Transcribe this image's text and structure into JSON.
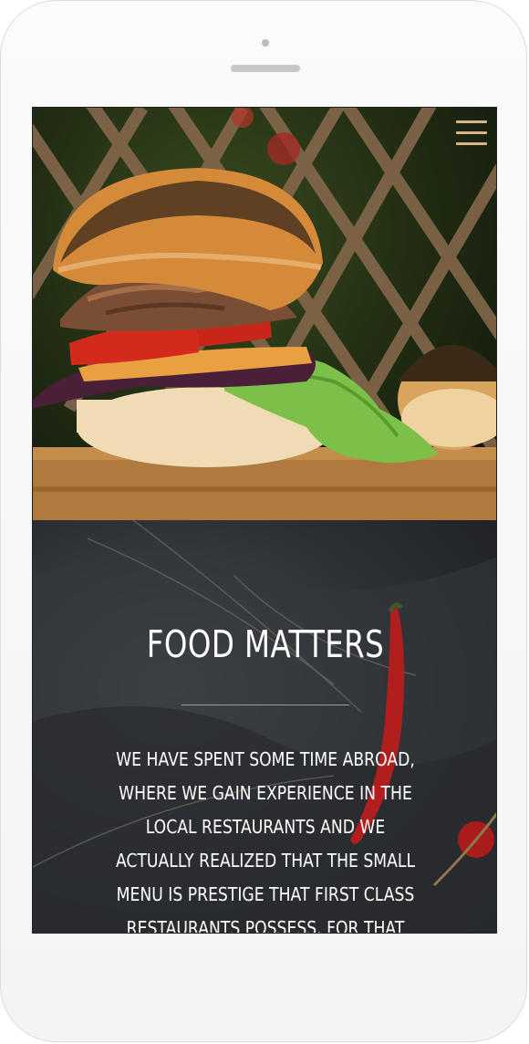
{
  "nav": {
    "menu_icon": "hamburger-icon"
  },
  "hero": {
    "image": "burger-photo"
  },
  "about": {
    "title": "FOOD MATTERS",
    "text": "WE HAVE SPENT SOME TIME ABROAD, WHERE WE GAIN EXPERIENCE IN THE LOCAL RESTAURANTS AND WE ACTUALLY REALIZED THAT THE SMALL MENU IS PRESTIGE THAT FIRST CLASS RESTAURANTS POSSESS. FOR THAT"
  },
  "colors": {
    "accent": "#d8b48a",
    "title": "#ffffff",
    "divider": "#9a9a9a"
  }
}
